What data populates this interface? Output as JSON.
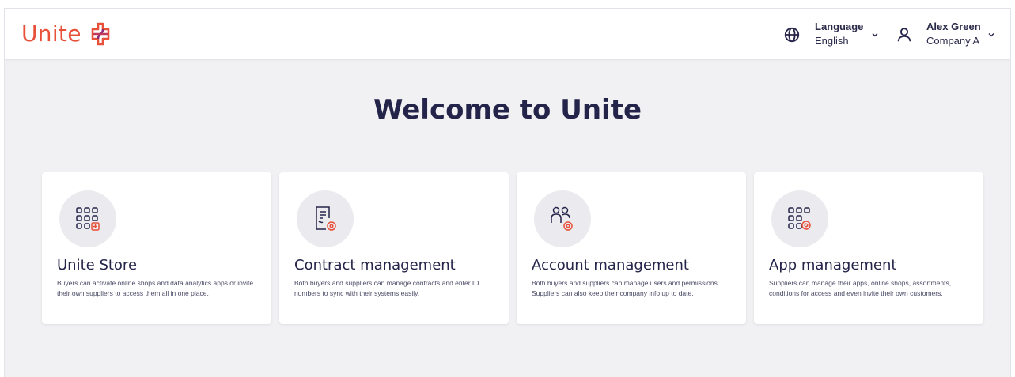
{
  "header": {
    "logo_text": "Unite",
    "language": {
      "label": "Language",
      "value": "English"
    },
    "user": {
      "name": "Alex Green",
      "company": "Company A"
    }
  },
  "main": {
    "title": "Welcome to Unite",
    "cards": [
      {
        "icon": "apps-add-icon",
        "title": "Unite Store",
        "description": "Buyers can activate online shops and data analytics apps or invite their own suppliers to access them all in one place."
      },
      {
        "icon": "contract-settings-icon",
        "title": "Contract management",
        "description": "Both buyers and suppliers can manage contracts and enter ID numbers to sync with their systems easily."
      },
      {
        "icon": "users-settings-icon",
        "title": "Account management",
        "description": "Both buyers and suppliers can manage users and permissions. Suppliers can also keep their company info up to date."
      },
      {
        "icon": "apps-settings-icon",
        "title": "App management",
        "description": "Suppliers can manage their apps, online shops, assortments, conditions for access and even invite their own customers."
      }
    ]
  },
  "colors": {
    "brand": "#e8503a",
    "brand_secondary": "#8b2b7a",
    "navy": "#24244a",
    "background": "#f1f1f4"
  }
}
